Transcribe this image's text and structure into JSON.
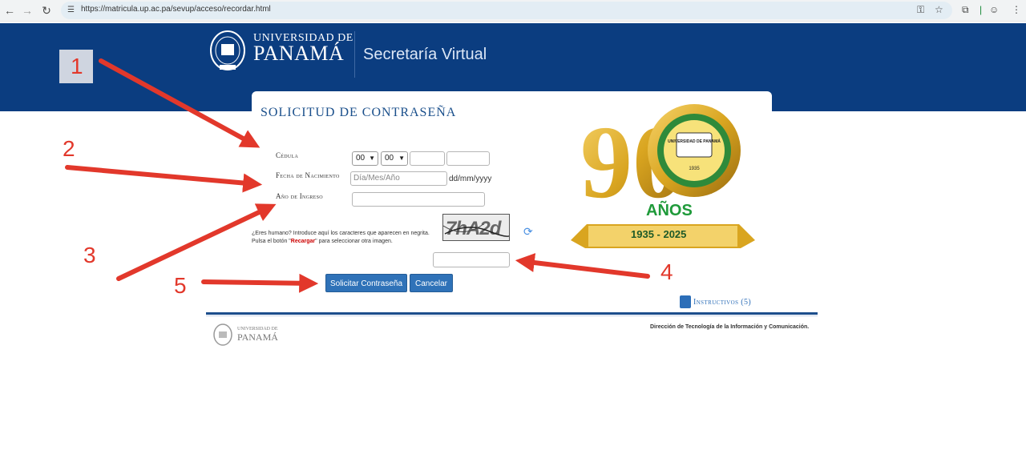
{
  "browser": {
    "url": "https://matricula.up.ac.pa/sevup/acceso/recordar.html"
  },
  "header": {
    "logo_line1": "UNIVERSIDAD DE",
    "logo_line2": "PANAMÁ",
    "title": "Secretaría Virtual"
  },
  "form": {
    "title": "SOLICITUD DE CONTRASEÑA",
    "cedula_label": "Cédula",
    "cedula_prov": "00",
    "cedula_tomo": "00",
    "fecha_label": "Fecha de Nacimiento",
    "fecha_placeholder": "Día/Mes/Año",
    "fecha_format": "dd/mm/yyyy",
    "ingreso_label": "Año de Ingreso",
    "captcha_help_1": "¿Eres humano? Introduce aquí los caracteres que aparecen en negrita. Pulsa el botón \"",
    "captcha_help_reload": "Recargar",
    "captcha_help_2": "\" para seleccionar otra imagen.",
    "captcha_text": "7hA2d",
    "submit_label": "Solicitar Contraseña",
    "cancel_label": "Cancelar"
  },
  "badge": {
    "number": "90",
    "anos": "AÑOS",
    "years": "1935 - 2025",
    "seal_text": "UNIVERSIDAD DE PANAMÁ",
    "seal_year": "1935"
  },
  "instructivos": {
    "label": "Instructivos (5)"
  },
  "footer": {
    "logo_line1": "UNIVERSIDAD DE",
    "logo_line2": "PANAMÁ",
    "direccion": "Dirección de Tecnología de la Información y Comunicación."
  },
  "annotations": {
    "n1": "1",
    "n2": "2",
    "n3": "3",
    "n4": "4",
    "n5": "5"
  },
  "colors": {
    "header_bg": "#0b3d80",
    "button_bg": "#2f72b8",
    "annotation_red": "#e2382b",
    "badge_gold": "#d9a520",
    "anos_green": "#1f9a3a"
  }
}
